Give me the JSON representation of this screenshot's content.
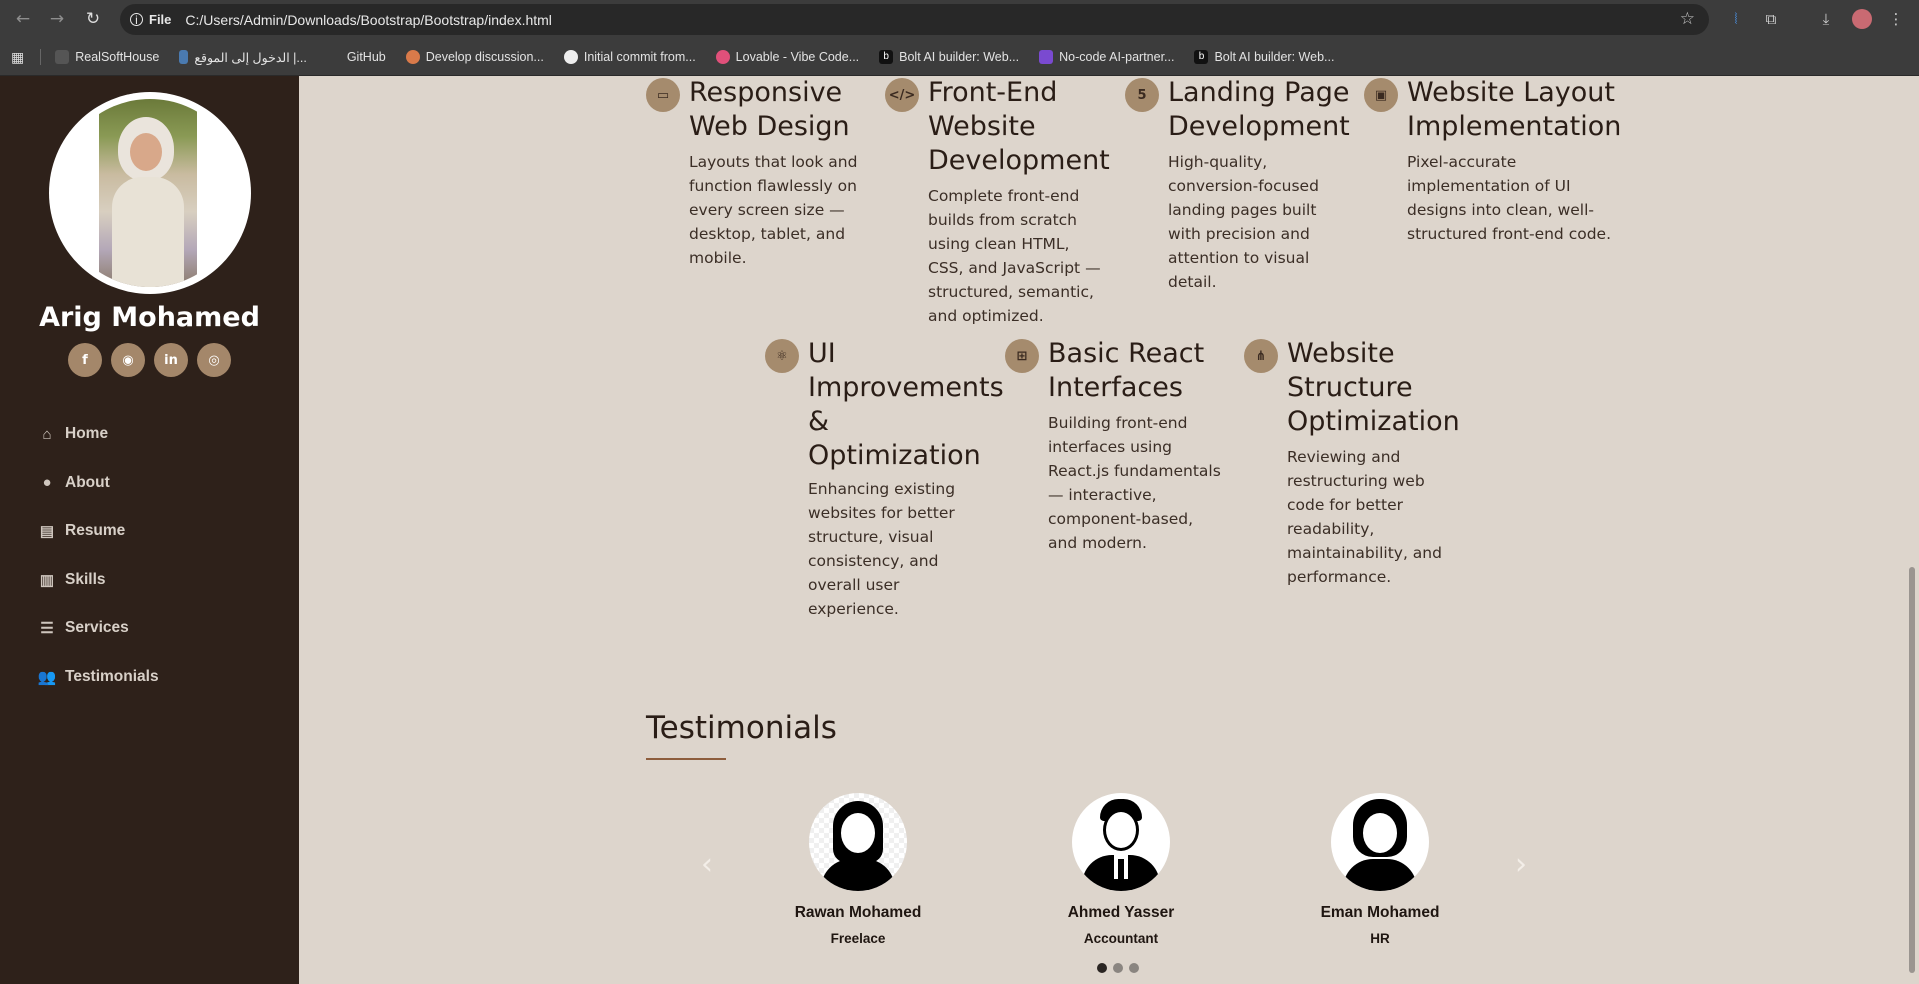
{
  "browser": {
    "url": "C:/Users/Admin/Downloads/Bootstrap/Bootstrap/index.html",
    "file_chip": "File",
    "bookmarks": [
      "RealSoftHouse",
      "الدخول إلى الموقع |...",
      "GitHub",
      "Develop discussion...",
      "Initial commit from...",
      "Lovable - Vibe Code...",
      "Bolt AI builder: Web...",
      "No-code AI-partner...",
      "Bolt AI builder: Web..."
    ]
  },
  "profile": {
    "name": "Arig Mohamed",
    "socials": [
      "facebook-icon",
      "github-icon",
      "linkedin-icon",
      "instagram-icon"
    ]
  },
  "menu": [
    {
      "label": "Home",
      "icon": "home-icon"
    },
    {
      "label": "About",
      "icon": "user-icon"
    },
    {
      "label": "Resume",
      "icon": "file-icon"
    },
    {
      "label": "Skills",
      "icon": "book-icon"
    },
    {
      "label": "Services",
      "icon": "server-icon"
    },
    {
      "label": "Testimonials",
      "icon": "users-icon"
    }
  ],
  "services": [
    {
      "title": "Responsive Web Design",
      "desc": "Layouts that look and function flawlessly on every screen size — desktop, tablet, and mobile.",
      "icon": "laptop-icon"
    },
    {
      "title": "Front-End Website Development",
      "desc": "Complete front-end builds from scratch using clean HTML, CSS, and JavaScript — structured, semantic, and optimized.",
      "icon": "code-icon"
    },
    {
      "title": "Landing Page Development",
      "desc": "High-quality, conversion-focused landing pages built with precision and attention to visual detail.",
      "icon": "html5-icon"
    },
    {
      "title": "Website Layout Implementation",
      "desc": "Pixel-accurate implementation of UI designs into clean, well-structured front-end code.",
      "icon": "layout-icon"
    },
    {
      "title": "UI Improvements & Optimization",
      "desc": "Enhancing existing websites for better structure, visual consistency, and overall user experience.",
      "icon": "react-icon"
    },
    {
      "title": "Basic React Interfaces",
      "desc": "Building front-end interfaces using React.js fundamentals — interactive, component-based, and modern.",
      "icon": "components-icon"
    },
    {
      "title": "Website Structure Optimization",
      "desc": "Reviewing and restructuring web code for better readability, maintainability, and performance.",
      "icon": "sitemap-icon"
    }
  ],
  "testimonials": {
    "title": "Testimonials",
    "items": [
      {
        "name": "Rawan Mohamed",
        "role": "Freelace"
      },
      {
        "name": "Ahmed Yasser",
        "role": "Accountant"
      },
      {
        "name": "Eman Mohamed",
        "role": "HR"
      }
    ]
  },
  "colors": {
    "sidebar": "#2e211a",
    "background": "#ddd5cc",
    "accent": "#a58b6d",
    "underline": "#8d5d3c"
  }
}
